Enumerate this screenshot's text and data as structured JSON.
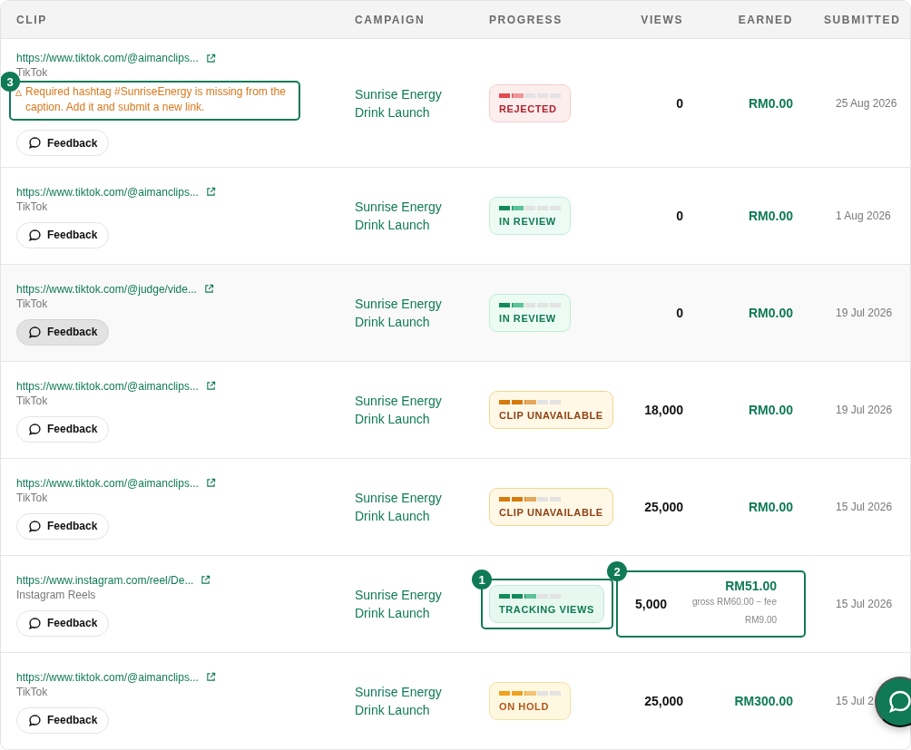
{
  "table": {
    "columns": [
      "CLIP",
      "CAMPAIGN",
      "PROGRESS",
      "VIEWS",
      "EARNED",
      "SUBMITTED"
    ],
    "rows": [
      {
        "url": "https://www.tiktok.com/@aimanclips...",
        "platform": "TikTok",
        "note": "Required hashtag #SunriseEnergy is missing from the caption. Add it and submit a new link.",
        "note_callout": "3",
        "feedback": "Feedback",
        "campaign": "Sunrise Energy Drink Launch",
        "status": {
          "kind": "rejected",
          "label": "REJECTED",
          "level": 0.4
        },
        "views": "0",
        "earned": "RM0.00",
        "submitted": "25 Aug 2026",
        "highlighted": false
      },
      {
        "url": "https://www.tiktok.com/@aimanclips...",
        "platform": "TikTok",
        "feedback": "Feedback",
        "campaign": "Sunrise Energy Drink Launch",
        "status": {
          "kind": "review",
          "label": "IN REVIEW",
          "level": 0.4
        },
        "views": "0",
        "earned": "RM0.00",
        "submitted": "1 Aug 2026",
        "highlighted": false
      },
      {
        "url": "https://www.tiktok.com/@judge/vide...",
        "platform": "TikTok",
        "feedback": "Feedback",
        "campaign": "Sunrise Energy Drink Launch",
        "status": {
          "kind": "review",
          "label": "IN REVIEW",
          "level": 0.4
        },
        "views": "0",
        "earned": "RM0.00",
        "submitted": "19 Jul 2026",
        "highlighted": true
      },
      {
        "url": "https://www.tiktok.com/@aimanclips...",
        "platform": "TikTok",
        "feedback": "Feedback",
        "campaign": "Sunrise Energy Drink Launch",
        "status": {
          "kind": "unavailable",
          "label": "CLIP UNAVAILABLE",
          "level": 0.6
        },
        "views": "18,000",
        "earned": "RM0.00",
        "submitted": "19 Jul 2026",
        "highlighted": false
      },
      {
        "url": "https://www.tiktok.com/@aimanclips...",
        "platform": "TikTok",
        "feedback": "Feedback",
        "campaign": "Sunrise Energy Drink Launch",
        "status": {
          "kind": "unavailable",
          "label": "CLIP UNAVAILABLE",
          "level": 0.6
        },
        "views": "25,000",
        "earned": "RM0.00",
        "submitted": "15 Jul 2026",
        "highlighted": false
      },
      {
        "url": "https://www.instagram.com/reel/De...",
        "platform": "Instagram Reels",
        "feedback": "Feedback",
        "campaign": "Sunrise Energy Drink Launch",
        "status": {
          "kind": "tracking",
          "label": "TRACKING VIEWS",
          "level": 0.6
        },
        "progress_callout": "1",
        "views": "5,000",
        "earned": "RM51.00",
        "earned_detail": "gross RM60.00 − fee RM9.00",
        "stats_callout": "2",
        "submitted": "15 Jul 2026",
        "highlighted": false
      },
      {
        "url": "https://www.tiktok.com/@aimanclips...",
        "platform": "TikTok",
        "feedback": "Feedback",
        "campaign": "Sunrise Energy Drink Launch",
        "status": {
          "kind": "hold",
          "label": "ON HOLD",
          "level": 0.6
        },
        "views": "25,000",
        "earned": "RM300.00",
        "submitted": "15 Jul 2",
        "highlighted": false
      }
    ]
  }
}
